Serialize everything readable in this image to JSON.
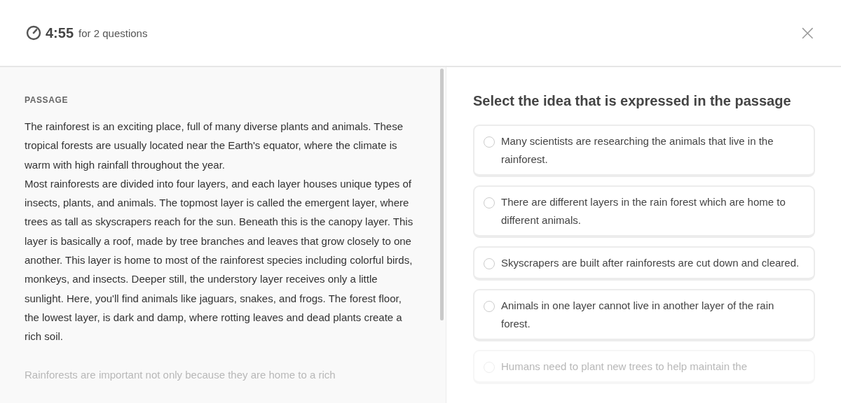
{
  "header": {
    "timer": "4:55",
    "timer_caption": "for 2 questions",
    "close": "×"
  },
  "passage": {
    "label": "PASSAGE",
    "paragraphs": [
      {
        "text": "The rainforest is an exciting place, full of many diverse plants and animals. These tropical forests are usually located near the Earth's equator, where the climate is warm with high rainfall throughout the year.",
        "faded": false
      },
      {
        "text": "Most rainforests are divided into four layers, and each layer houses unique types of insects, plants, and animals. The topmost layer is called the emergent layer, where trees as tall as skyscrapers reach for the sun. Beneath this is the canopy layer. This layer is basically a roof, made by tree branches and leaves that grow closely to one another. This layer is home to most of the rainforest species including colorful birds, monkeys, and insects. Deeper still, the understory layer receives only a little sunlight. Here, you'll find animals like jaguars, snakes, and frogs. The forest floor, the lowest layer, is dark and damp, where rotting leaves and dead plants create a rich soil.",
        "faded": false
      },
      {
        "text": "Rainforests are important not only because they are home to a rich",
        "faded": true
      }
    ]
  },
  "question": {
    "prompt": "Select the idea that is expressed in the passage",
    "options": [
      {
        "text": "Many scientists are researching the animals that live in the rainforest.",
        "selected": false,
        "faded": false
      },
      {
        "text": "There are different layers in the rain forest which are home to different animals.",
        "selected": false,
        "faded": false
      },
      {
        "text": "Skyscrapers are built after rainforests are cut down and cleared.",
        "selected": false,
        "faded": false
      },
      {
        "text": "Animals in one layer cannot live in another layer of the rain forest.",
        "selected": false,
        "faded": false
      },
      {
        "text": "Humans need to plant new trees to help maintain the",
        "selected": false,
        "faded": true
      }
    ]
  }
}
